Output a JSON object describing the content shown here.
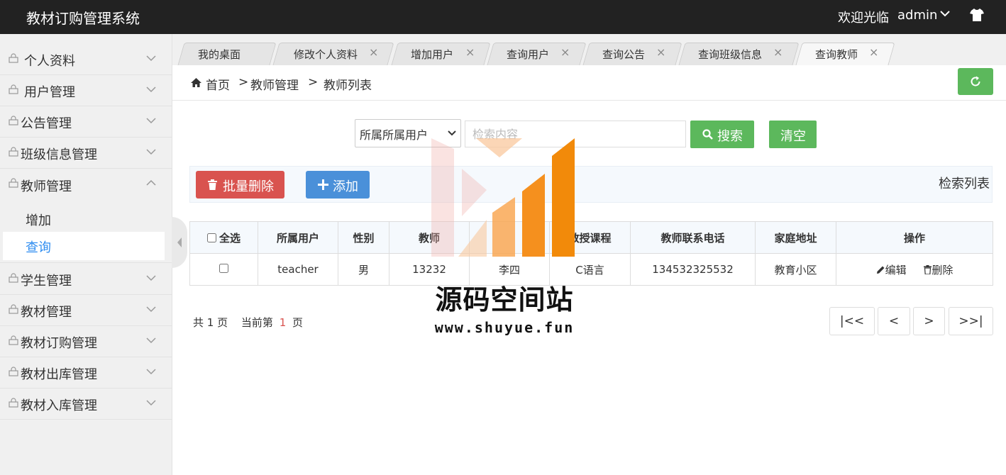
{
  "app": {
    "title": "教材订购管理系统"
  },
  "header": {
    "welcome": "欢迎光临",
    "username": "admin"
  },
  "sidebar": {
    "items": [
      {
        "label": "个人资料"
      },
      {
        "label": "用户管理"
      },
      {
        "label": "公告管理"
      },
      {
        "label": "班级信息管理"
      },
      {
        "label": "教师管理"
      },
      {
        "label": "学生管理"
      },
      {
        "label": "教材管理"
      },
      {
        "label": "教材订购管理"
      },
      {
        "label": "教材出库管理"
      },
      {
        "label": "教材入库管理"
      }
    ],
    "subitems": [
      {
        "label": "增加"
      },
      {
        "label": "查询"
      }
    ]
  },
  "tabs": [
    {
      "label": "我的桌面"
    },
    {
      "label": "修改个人资料"
    },
    {
      "label": "增加用户"
    },
    {
      "label": "查询用户"
    },
    {
      "label": "查询公告"
    },
    {
      "label": "查询班级信息"
    },
    {
      "label": "查询教师"
    }
  ],
  "breadcrumb": [
    "首页",
    "教师管理",
    "教师列表"
  ],
  "breadcrumb_sep": ">",
  "search": {
    "select_value": "所属所属用户",
    "placeholder": "检索内容",
    "search_label": "搜索",
    "clear_label": "清空"
  },
  "actions": {
    "batch_delete_label": "批量删除",
    "add_label": "添加",
    "list_label": "检索列表"
  },
  "table": {
    "select_all_label": "全选",
    "columns": [
      "所属用户",
      "性别",
      "教师编号",
      "教师姓名",
      "教授课程",
      "教师联系电话",
      "家庭地址",
      "操作"
    ],
    "visible_columns": [
      "所属用户",
      "性别",
      "教师",
      "",
      "教授课程",
      "教师联系电话",
      "家庭地址",
      "操作"
    ],
    "rows": [
      {
        "user": "teacher",
        "gender": "男",
        "id": "13232",
        "name": "李四",
        "course": "C语言",
        "phone": "134532325532",
        "address": "教育小区",
        "edit": "编辑",
        "delete": "删除"
      }
    ]
  },
  "pagination": {
    "total_prefix": "共",
    "total_pages": "1",
    "total_suffix": "页",
    "current_prefix": "当前第",
    "current_page": "1",
    "current_suffix": "页",
    "first": "|<<",
    "prev": "<",
    "next": ">",
    "last": ">>|"
  },
  "watermark": {
    "title": "源码空间站",
    "url": "www.shuyue.fun"
  },
  "colors": {
    "primary": "#4a90d9",
    "success": "#5cb85c",
    "danger": "#d9534f",
    "active_link": "#2d8cf0",
    "header_bg": "#222222"
  }
}
